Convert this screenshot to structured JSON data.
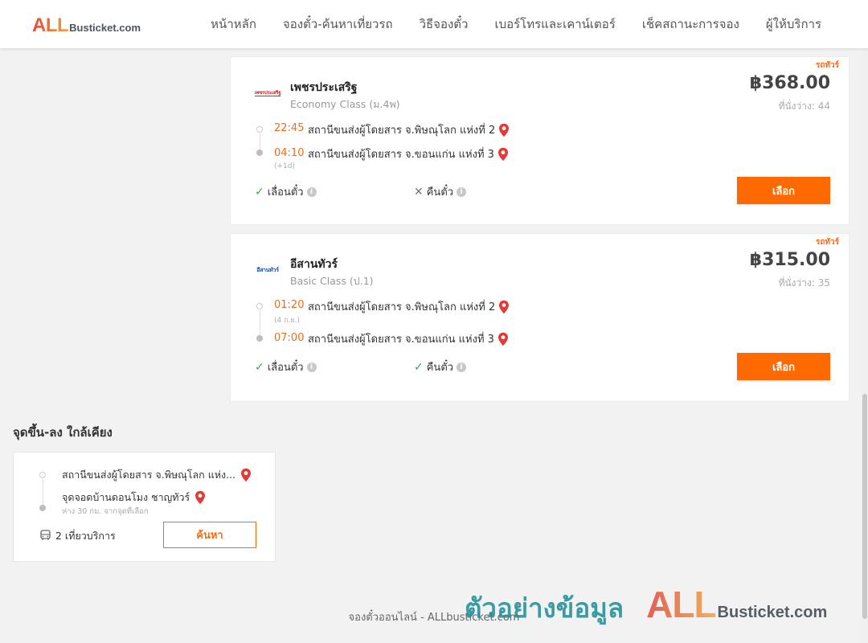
{
  "header": {
    "logo_all": "ALL",
    "logo_rest": "Busticket.com",
    "nav": [
      "หน้าหลัก",
      "จองตั๋ว-ค้นหาเที่ยวรถ",
      "วิธีจองตั๋ว",
      "เบอร์โทรและเคาน์เตอร์",
      "เช็คสถานะการจอง",
      "ผู้ให้บริการ"
    ]
  },
  "trips": [
    {
      "promo": "รถทัวร์",
      "operator_logo_text": "เพชรประเสริฐ",
      "operator": "เพชรประเสริฐ",
      "class": "Economy Class (ม.4พ)",
      "price": "฿368.00",
      "seats": "ที่นั่งว่าง: 44",
      "depart_time": "22:45",
      "depart_station": "สถานีขนส่งผู้โดยสาร จ.พิษณุโลก แห่งที่ 2",
      "arrive_time": "04:10",
      "arrive_note": "(+1d)",
      "arrive_station": "สถานีขนส่งผู้โดยสาร จ.ขอนแก่น แห่งที่ 3",
      "feature1": "เลื่อนตั๋ว",
      "feature1_ok": true,
      "feature2": "คืนตั๋ว",
      "feature2_ok": false,
      "select_label": "เลือก"
    },
    {
      "promo": "รถทัวร์",
      "operator_logo_text": "อีสานทัวร์",
      "operator": "อีสานทัวร์",
      "class": "Basic Class (ป.1)",
      "price": "฿315.00",
      "seats": "ที่นั่งว่าง: 35",
      "depart_time": "01:20",
      "depart_note": "(4 ก.ย.)",
      "depart_station": "สถานีขนส่งผู้โดยสาร จ.พิษณุโลก แห่งที่ 2",
      "arrive_time": "07:00",
      "arrive_station": "สถานีขนส่งผู้โดยสาร จ.ขอนแก่น แห่งที่ 3",
      "feature1": "เลื่อนตั๋ว",
      "feature1_ok": true,
      "feature2": "คืนตั๋ว",
      "feature2_ok": true,
      "select_label": "เลือก"
    }
  ],
  "nearby": {
    "title": "จุดขึ้น-ลง ใกล้เคียง",
    "from_station": "สถานีขนส่งผู้โดยสาร จ.พิษณุโลก แห่ง...",
    "to_station": "จุดจอดบ้านดอนโมง ชาญทัวร์",
    "distance": "ห่าง 30 กม. จากจุดที่เลือก",
    "trips": "2 เที่ยวบริการ",
    "search_label": "ค้นหา"
  },
  "footer": {
    "text": "จองตั๋วออนไลน์ - ALLbusticket.com"
  },
  "watermark": {
    "thai": "ตัวอย่างข้อมูล",
    "all": "ALL",
    "rest": "Busticket.com"
  },
  "colors": {
    "accent": "#ff6a00",
    "time": "#f26b1d",
    "ok": "#3aa845",
    "pin": "#e53935"
  }
}
